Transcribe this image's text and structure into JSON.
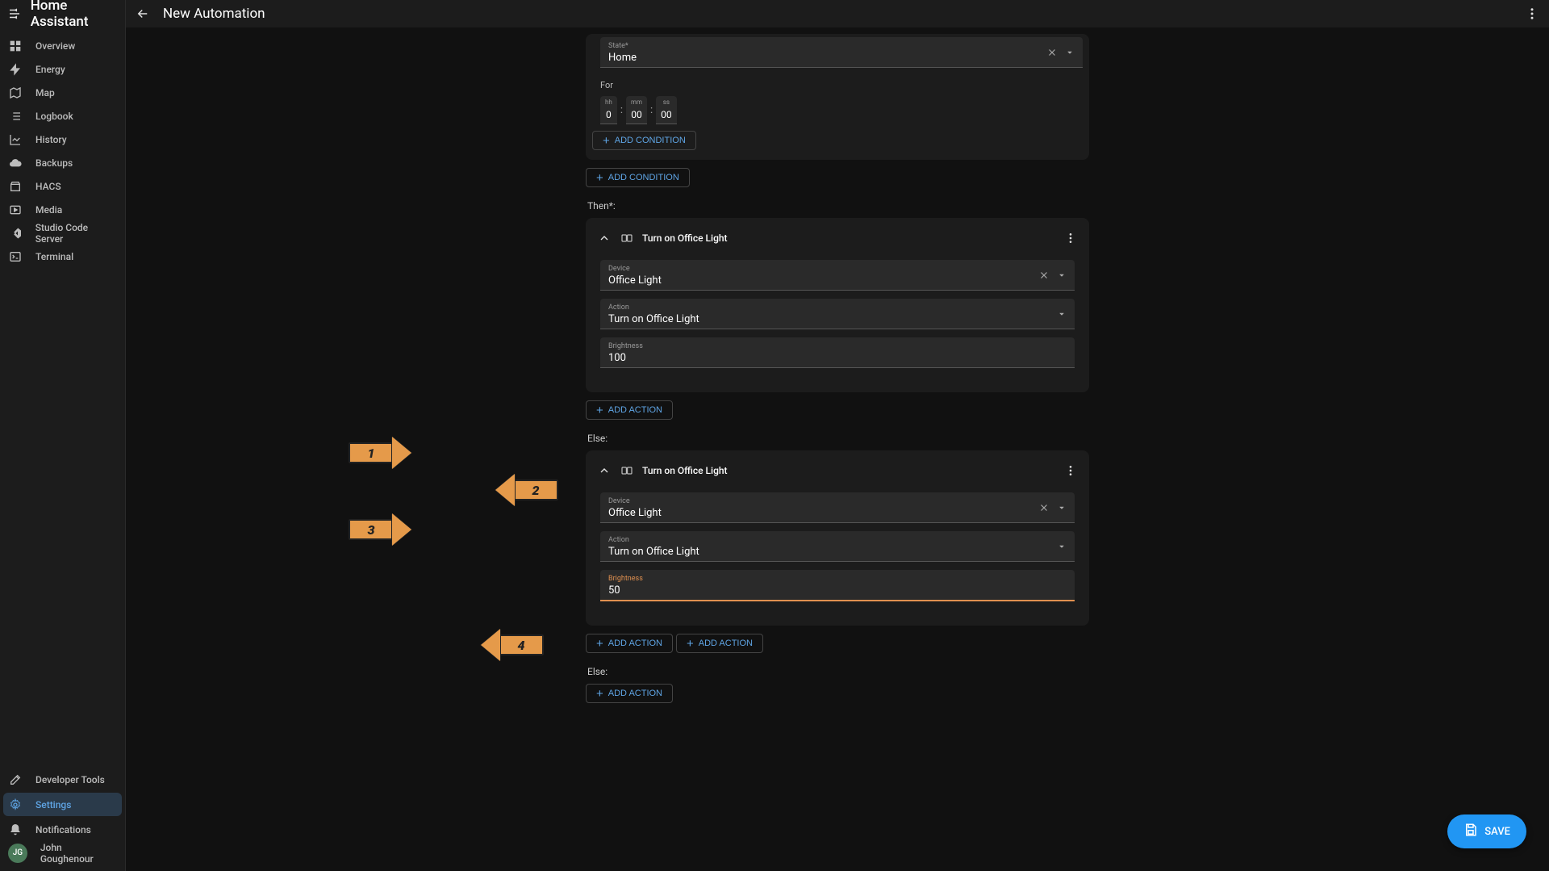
{
  "app": {
    "title": "Home Assistant",
    "page_title": "New Automation"
  },
  "sidebar": {
    "items": [
      {
        "label": "Overview"
      },
      {
        "label": "Energy"
      },
      {
        "label": "Map"
      },
      {
        "label": "Logbook"
      },
      {
        "label": "History"
      },
      {
        "label": "Backups"
      },
      {
        "label": "HACS"
      },
      {
        "label": "Media"
      },
      {
        "label": "Studio Code Server"
      },
      {
        "label": "Terminal"
      }
    ],
    "bottom": {
      "dev_tools": "Developer Tools",
      "settings": "Settings",
      "notifications": "Notifications",
      "user_initials": "JG",
      "user_name": "John Goughenour"
    }
  },
  "editor": {
    "state_field": {
      "label": "State*",
      "value": "Home"
    },
    "for_label": "For",
    "for_time": {
      "hh_label": "hh",
      "mm_label": "mm",
      "ss_label": "ss",
      "hh": "0",
      "mm": "00",
      "ss": "00"
    },
    "add_condition": "ADD CONDITION",
    "then_label": "Then*:",
    "else_label": "Else:",
    "then_action": {
      "title": "Turn on Office Light",
      "device": {
        "label": "Device",
        "value": "Office Light"
      },
      "action": {
        "label": "Action",
        "value": "Turn on Office Light"
      },
      "brightness": {
        "label": "Brightness",
        "value": "100"
      }
    },
    "else_action": {
      "title": "Turn on Office Light",
      "device": {
        "label": "Device",
        "value": "Office Light"
      },
      "action": {
        "label": "Action",
        "value": "Turn on Office Light"
      },
      "brightness": {
        "label": "Brightness",
        "value": "50"
      }
    },
    "add_action": "ADD ACTION"
  },
  "fab": {
    "label": "SAVE"
  },
  "annotations": {
    "a1": "1",
    "a2": "2",
    "a3": "3",
    "a4": "4"
  }
}
